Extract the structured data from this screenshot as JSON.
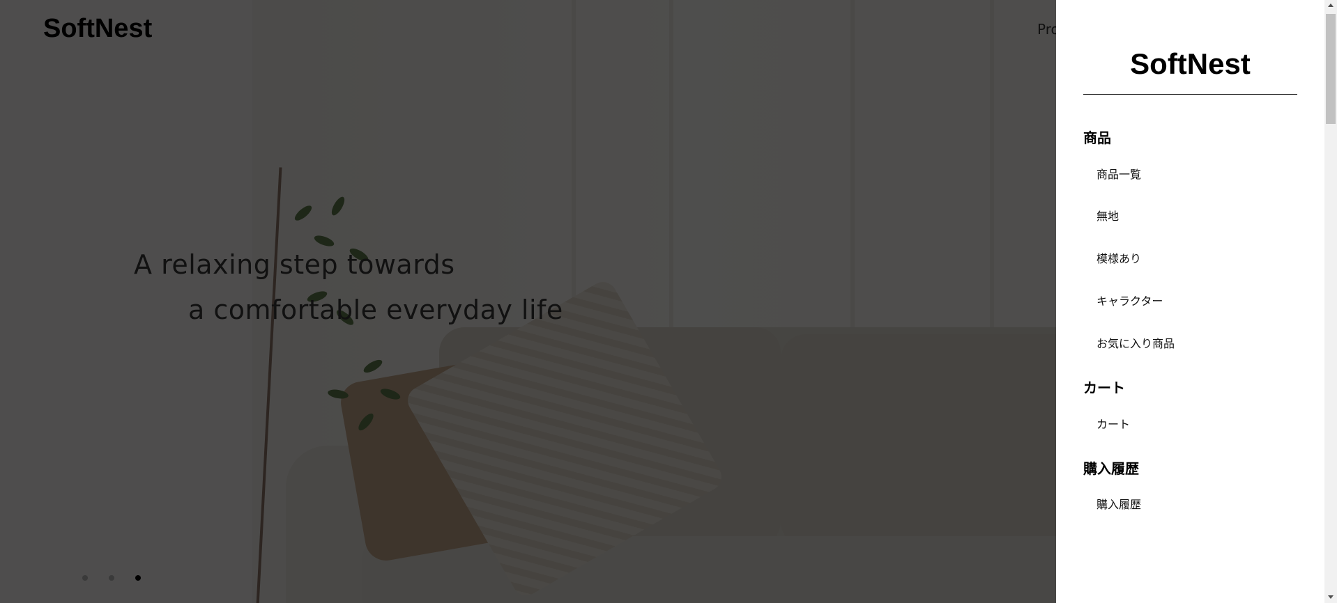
{
  "header": {
    "logo": "SoftNest",
    "nav_peek_text": "Pro"
  },
  "hero": {
    "line1": "A relaxing step towards",
    "line2": "a comfortable everyday life",
    "slides_total": 3,
    "active_slide": 3
  },
  "drawer": {
    "logo": "SoftNest",
    "sections": [
      {
        "title": "商品",
        "items": [
          "商品一覧",
          "無地",
          "模様あり",
          "キャラクター",
          "お気に入り商品"
        ]
      },
      {
        "title": "カート",
        "items": [
          "カート"
        ]
      },
      {
        "title": "購入履歴",
        "items": [
          "購入履歴"
        ]
      }
    ]
  },
  "colors": {
    "overlay": "rgba(0,0,0,0.68)",
    "drawer_bg": "#ffffff",
    "text": "#000000"
  }
}
